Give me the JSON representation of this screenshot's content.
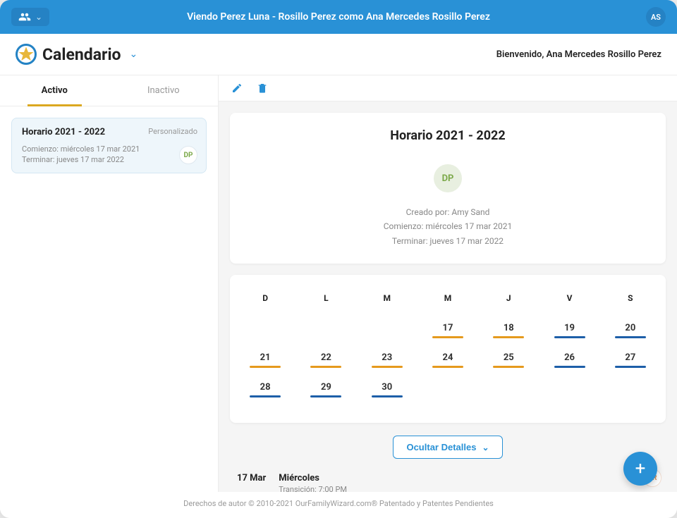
{
  "topbar": {
    "title": "Viendo Perez Luna - Rosillo Perez como Ana Mercedes Rosillo Perez",
    "avatar": "AS"
  },
  "subheader": {
    "page_title": "Calendario",
    "welcome": "Bienvenido, Ana Mercedes Rosillo Perez"
  },
  "tabs": {
    "active": "Activo",
    "inactive": "Inactivo"
  },
  "schedule_card": {
    "title": "Horario 2021 - 2022",
    "badge": "Personalizado",
    "start": "Comienzo: miércoles 17 mar 2021",
    "end": "Terminar: jueves 17 mar 2022",
    "avatar": "DP"
  },
  "detail_panel": {
    "title": "Horario 2021 - 2022",
    "avatar": "DP",
    "created_by": "Creado por: Amy Sand",
    "start": "Comienzo: miércoles 17 mar 2021",
    "end": "Terminar: jueves 17 mar 2022"
  },
  "calendar": {
    "headers": [
      "D",
      "L",
      "M",
      "M",
      "J",
      "V",
      "S"
    ],
    "cells": [
      {
        "label": "",
        "color": ""
      },
      {
        "label": "",
        "color": ""
      },
      {
        "label": "",
        "color": ""
      },
      {
        "label": "17",
        "color": "orange"
      },
      {
        "label": "18",
        "color": "orange"
      },
      {
        "label": "19",
        "color": "blue"
      },
      {
        "label": "20",
        "color": "blue"
      },
      {
        "label": "21",
        "color": "orange"
      },
      {
        "label": "22",
        "color": "orange"
      },
      {
        "label": "23",
        "color": "orange"
      },
      {
        "label": "24",
        "color": "orange"
      },
      {
        "label": "25",
        "color": "orange"
      },
      {
        "label": "26",
        "color": "blue"
      },
      {
        "label": "27",
        "color": "blue"
      },
      {
        "label": "28",
        "color": "blue"
      },
      {
        "label": "29",
        "color": "blue"
      },
      {
        "label": "30",
        "color": "blue"
      },
      {
        "label": "",
        "color": ""
      },
      {
        "label": "",
        "color": ""
      },
      {
        "label": "",
        "color": ""
      },
      {
        "label": "",
        "color": ""
      }
    ]
  },
  "hide_details_label": "Ocultar Detalles",
  "day_detail": {
    "date": "17 Mar",
    "dow": "Miércoles",
    "transition": "Transición: 7:00 PM",
    "avatar": "AR"
  },
  "footer": "Derechos de autor © 2010-2021 OurFamilyWizard.com® Patentado y Patentes Pendientes"
}
